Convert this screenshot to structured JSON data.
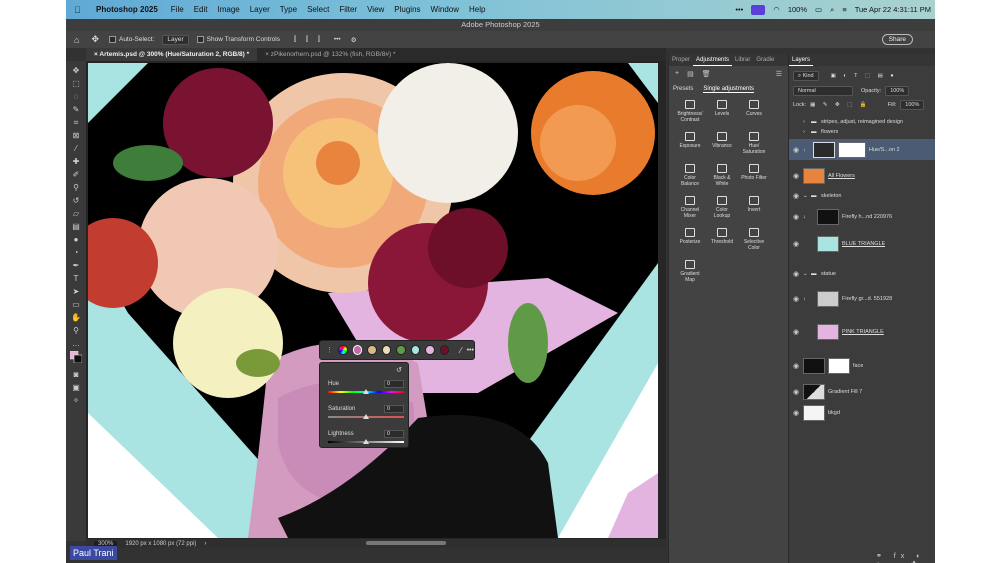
{
  "menubar": {
    "app_name": "Photoshop 2025",
    "items": [
      "File",
      "Edit",
      "Image",
      "Layer",
      "Type",
      "Select",
      "Filter",
      "View",
      "Plugins",
      "Window",
      "Help"
    ],
    "battery": "100%",
    "clock": "Tue Apr 22  4:31:11 PM"
  },
  "window_title": "Adobe Photoshop 2025",
  "options_bar": {
    "auto_select_label": "Auto-Select:",
    "auto_select_value": "Layer",
    "transform_label": "Show Transform Controls",
    "share_label": "Share"
  },
  "doc_tabs": [
    {
      "label": "Artemis.psd @ 300% (Hue/Saturation 2, RGB/8) *"
    },
    {
      "label": "zPikenorhern.psd @ 132% (fish, RGB/8#) *"
    }
  ],
  "status": {
    "zoom": "300%",
    "doc_size": "1920 px x 1080 px (72 ppi)"
  },
  "adjustments": {
    "tabs": [
      "Proper",
      "Adjustments",
      "Librar",
      "Gradie"
    ],
    "presets_label": "Presets",
    "single_label": "Single adjustments",
    "items": [
      "Brightness/\nContrast",
      "Levels",
      "Curves",
      "Exposure",
      "Vibrance",
      "Hue/\nSaturation",
      "Color\nBalance",
      "Black &\nWhite",
      "Photo Filter",
      "Channel\nMixer",
      "Color\nLookup",
      "Invert",
      "Posterize",
      "Threshold",
      "Selective\nColor",
      "Gradient\nMap"
    ]
  },
  "layers": {
    "tab_label": "Layers",
    "kind_label": "Kind",
    "blend_mode": "Normal",
    "opacity_label": "Opacity:",
    "opacity_value": "100%",
    "lock_label": "Lock:",
    "fill_label": "Fill:",
    "fill_value": "100%",
    "rows": [
      {
        "name": "stripes, adjust, reimagined design"
      },
      {
        "name": "flowers"
      },
      {
        "name": "Hue/S...on 2"
      },
      {
        "name": "All Flowers"
      },
      {
        "name": "skeleton"
      },
      {
        "name": "Firefly h...nd 220976"
      },
      {
        "name": "BLUE TRIANGLE"
      },
      {
        "name": "statue"
      },
      {
        "name": "Firefly gr...d. 551928"
      },
      {
        "name": "PINK TRIANGLE"
      },
      {
        "name": "face"
      },
      {
        "name": "Gradient Fill 7"
      },
      {
        "name": "bkgd"
      }
    ]
  },
  "hue_sat": {
    "hue_label": "Hue",
    "hue_value": "0",
    "sat_label": "Saturation",
    "sat_value": "0",
    "light_label": "Lightness",
    "light_value": "0"
  },
  "watermark": "Paul Trani"
}
